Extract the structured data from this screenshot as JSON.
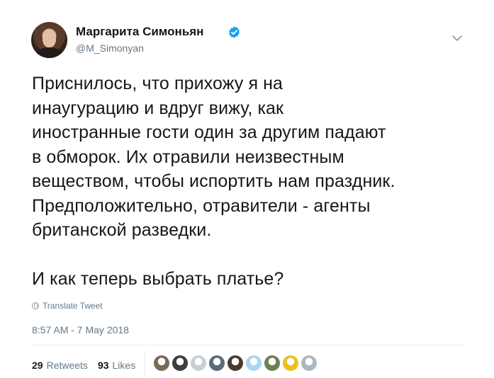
{
  "author": {
    "name": "Маргарита Симоньян",
    "handle": "@M_Simonyan"
  },
  "tweet": {
    "text": "Приснилось, что прихожу я на\nинаугурацию и вдруг вижу, как\nиностранные гости один за другим падают\nв обморок. Их отравили неизвестным\nвеществом, чтобы испортить нам праздник.\nПредположительно, отравители - агенты\nбританской разведки.\n\nИ как теперь выбрать платье?",
    "translate_label": "Translate Tweet",
    "timestamp": "8:57 AM - 7 May 2018"
  },
  "stats": {
    "retweets_count": "29",
    "retweets_label": "Retweets",
    "likes_count": "93",
    "likes_label": "Likes"
  },
  "colors": {
    "verified": "#1da1f2",
    "secondary_text": "#657786",
    "divider": "#e6ecf0"
  },
  "likers": [
    {
      "color": "#7a6a58"
    },
    {
      "color": "#3b3f3a"
    },
    {
      "color": "#c9cfd4"
    },
    {
      "color": "#5b6b7a"
    },
    {
      "color": "#4a3a2c"
    },
    {
      "color": "#a9d6f2"
    },
    {
      "color": "#6f7f56"
    },
    {
      "color": "#e8c21f"
    },
    {
      "color": "#aab8c2"
    }
  ]
}
